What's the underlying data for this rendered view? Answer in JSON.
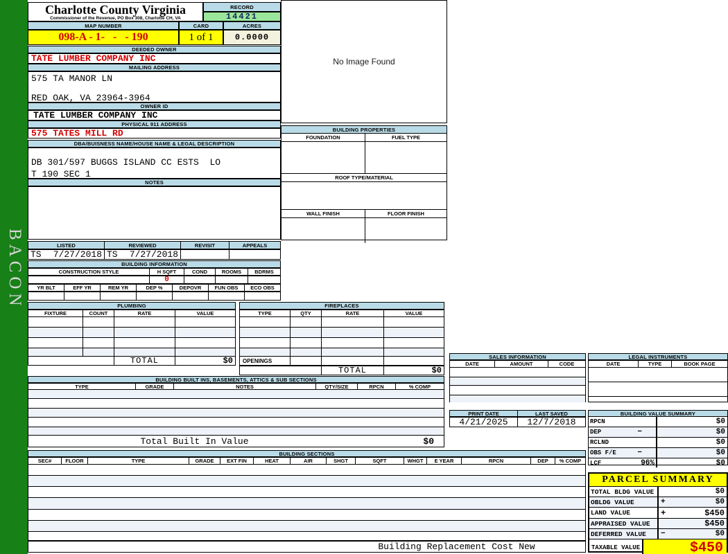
{
  "colors": {
    "sidebar_green": "#178017",
    "header_blue": "#B9DBE7",
    "highlight_yellow": "#FFFF00",
    "record_green": "#9AE69A",
    "acres_cream": "#F2F2DE",
    "alert_red": "#D40000",
    "stripe": "#EEF2F9"
  },
  "sidebar": {
    "label": "BACON"
  },
  "header": {
    "county_title": "Charlotte County Virginia",
    "county_subtitle": "Commissioner of the Revenue, PO Box 308, Charlotte CH, VA",
    "record_label": "RECORD",
    "record_value": "14421",
    "map_number_label": "MAP NUMBER",
    "map_number_value": "098-A - 1-   -   - 190",
    "card_label": "CARD",
    "card_value": "1 of 1",
    "acres_label": "ACRES",
    "acres_value": "0.0000"
  },
  "owner": {
    "deeded_owner_label": "DEEDED OWNER",
    "deeded_owner": "TATE LUMBER COMPANY INC",
    "mailing_address_label": "MAILING ADDRESS",
    "mailing_line1": "575 TA MANOR LN",
    "mailing_line2": "RED OAK, VA 23964-3964",
    "owner_id_label": "OWNER ID",
    "owner_id": "TATE LUMBER COMPANY INC",
    "physical_address_label": "PHYSICAL 911 ADDRESS",
    "physical_address": "575 TATES MILL RD",
    "dba_label": "DBA/BUISNESS NAME/HOUSE NAME & LEGAL DESCRIPTION",
    "legal_line1": "DB 301/597 BUGGS ISLAND CC ESTS  LO",
    "legal_line2": "T 190 SEC 1",
    "notes_label": "NOTES"
  },
  "image_panel": {
    "no_image_text": "No Image Found"
  },
  "building_properties": {
    "title": "BUILDING PROPERTIES",
    "foundation_label": "FOUNDATION",
    "fuel_type_label": "FUEL TYPE",
    "roof_label": "ROOF TYPE/MATERIAL",
    "wall_finish_label": "WALL FINISH",
    "floor_finish_label": "FLOOR FINISH"
  },
  "review": {
    "listed_label": "LISTED",
    "listed_by": "TS",
    "listed_date": "7/27/2018",
    "reviewed_label": "REVIEWED",
    "reviewed_by": "TS",
    "reviewed_date": "7/27/2018",
    "revisit_label": "REVISIT",
    "appeals_label": "APPEALS"
  },
  "building_information": {
    "title": "BUILDING INFORMATION",
    "row1_headers": [
      "CONSTRUCTION STYLE",
      "H SQFT",
      "COND",
      "ROOMS",
      "BDRMS"
    ],
    "h_sqft_value": "0",
    "row2_headers": [
      "YR BLT",
      "EFF YR",
      "REM YR",
      "DEP %",
      "DEPOVR",
      "FUN OBS",
      "ECO OBS"
    ]
  },
  "plumbing": {
    "title": "PLUMBING",
    "headers": [
      "FIXTURE",
      "COUNT",
      "RATE",
      "VALUE"
    ],
    "total_label": "TOTAL",
    "total_value": "$0"
  },
  "fireplaces": {
    "title": "FIREPLACES",
    "headers": [
      "TYPE",
      "QTY",
      "RATE",
      "VALUE"
    ],
    "openings_label": "OPENINGS",
    "total_label": "TOTAL",
    "total_value": "$0"
  },
  "built_ins": {
    "title": "BUILDING BUILT INS, BASEMENTS, ATTICS & SUB SECTIONS",
    "headers": [
      "TYPE",
      "GRADE",
      "NOTES",
      "QTY/SIZE",
      "RPCN",
      "% COMP"
    ],
    "total_label": "Total Built In Value",
    "total_value": "$0"
  },
  "building_sections": {
    "title": "BUILDING SECTIONS",
    "headers": [
      "SEC#",
      "FLOOR",
      "TYPE",
      "GRADE",
      "EXT FIN",
      "HEAT",
      "AIR",
      "SHGT",
      "SQFT",
      "WHGT",
      "E YEAR",
      "RPCN",
      "DEP",
      "% COMP"
    ]
  },
  "footer": {
    "label": "Building Replacement Cost New"
  },
  "sales": {
    "title": "SALES INFORMATION",
    "headers": [
      "DATE",
      "AMOUNT",
      "CODE"
    ]
  },
  "legal_instruments": {
    "title": "LEGAL INSTRUMENTS",
    "headers": [
      "DATE",
      "TYPE",
      "BOOK PAGE"
    ]
  },
  "dates": {
    "print_date_label": "PRINT DATE",
    "print_date": "4/21/2025",
    "last_saved_label": "LAST SAVED",
    "last_saved": "12/7/2018"
  },
  "building_value_summary": {
    "title": "BUILDING VALUE SUMMARY",
    "rows": [
      {
        "label": "RPCN",
        "sign": "",
        "pct": "",
        "value": "$0"
      },
      {
        "label": "DEP",
        "sign": "−",
        "pct": "",
        "value": "$0"
      },
      {
        "label": "RCLND",
        "sign": "",
        "pct": "",
        "value": "$0"
      },
      {
        "label": "OBS F/E",
        "sign": "−",
        "pct": "",
        "value": "$0"
      },
      {
        "label": "LCF",
        "sign": "",
        "pct": "96%",
        "value": "$0"
      }
    ]
  },
  "parcel_summary": {
    "title": "PARCEL SUMMARY",
    "rows": [
      {
        "label": "TOTAL BLDG VALUE",
        "sign": "",
        "value": "$0"
      },
      {
        "label": "OBLDG VALUE",
        "sign": "+",
        "value": "$0"
      },
      {
        "label": "LAND VALUE",
        "sign": "+",
        "value": "$450"
      },
      {
        "label": "APPRAISED VALUE",
        "sign": "",
        "value": "$450"
      },
      {
        "label": "DEFERRED VALUE",
        "sign": "−",
        "value": "$0"
      }
    ],
    "taxable_label": "TAXABLE VALUE",
    "taxable_value": "$450"
  }
}
